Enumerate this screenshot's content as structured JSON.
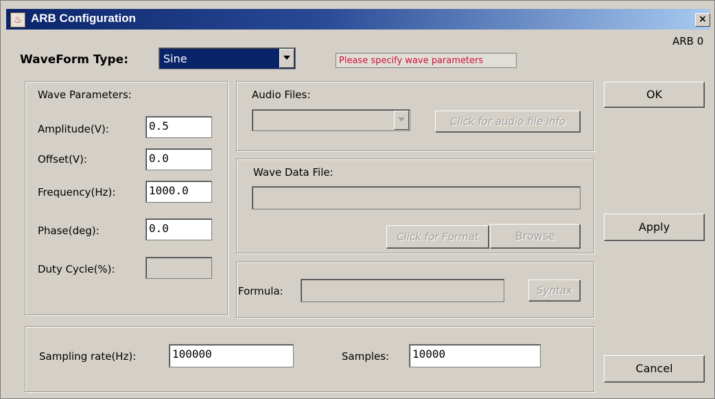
{
  "window": {
    "title": "ARB Configuration",
    "close_glyph": "×",
    "app_icon": "java-cup-icon",
    "arb_id": "ARB 0"
  },
  "waveform": {
    "label": "WaveForm Type:",
    "selected": "Sine",
    "hint": "Please specify wave parameters",
    "hint_color": "#d0103a"
  },
  "wave_params": {
    "title": "Wave Parameters:",
    "amplitude_label": "Amplitude(V):",
    "amplitude_value": "0.5",
    "offset_label": "Offset(V):",
    "offset_value": "0.0",
    "frequency_label": "Frequency(Hz):",
    "frequency_value": "1000.0",
    "phase_label": "Phase(deg):",
    "phase_value": "0.0",
    "duty_label": "Duty Cycle(%):",
    "duty_value": ""
  },
  "audio": {
    "title": "Audio Files:",
    "selected": "",
    "info_button": "Click for audio file info"
  },
  "wave_data": {
    "title": "Wave Data File:",
    "path": "",
    "format_button": "Click for Format",
    "browse_button": "Browse"
  },
  "formula": {
    "label": "Formula:",
    "value": "",
    "syntax_button": "Syntax"
  },
  "sampling": {
    "rate_label": "Sampling rate(Hz):",
    "rate_value": "100000",
    "samples_label": "Samples:",
    "samples_value": "10000"
  },
  "buttons": {
    "ok": "OK",
    "apply": "Apply",
    "cancel": "Cancel"
  }
}
